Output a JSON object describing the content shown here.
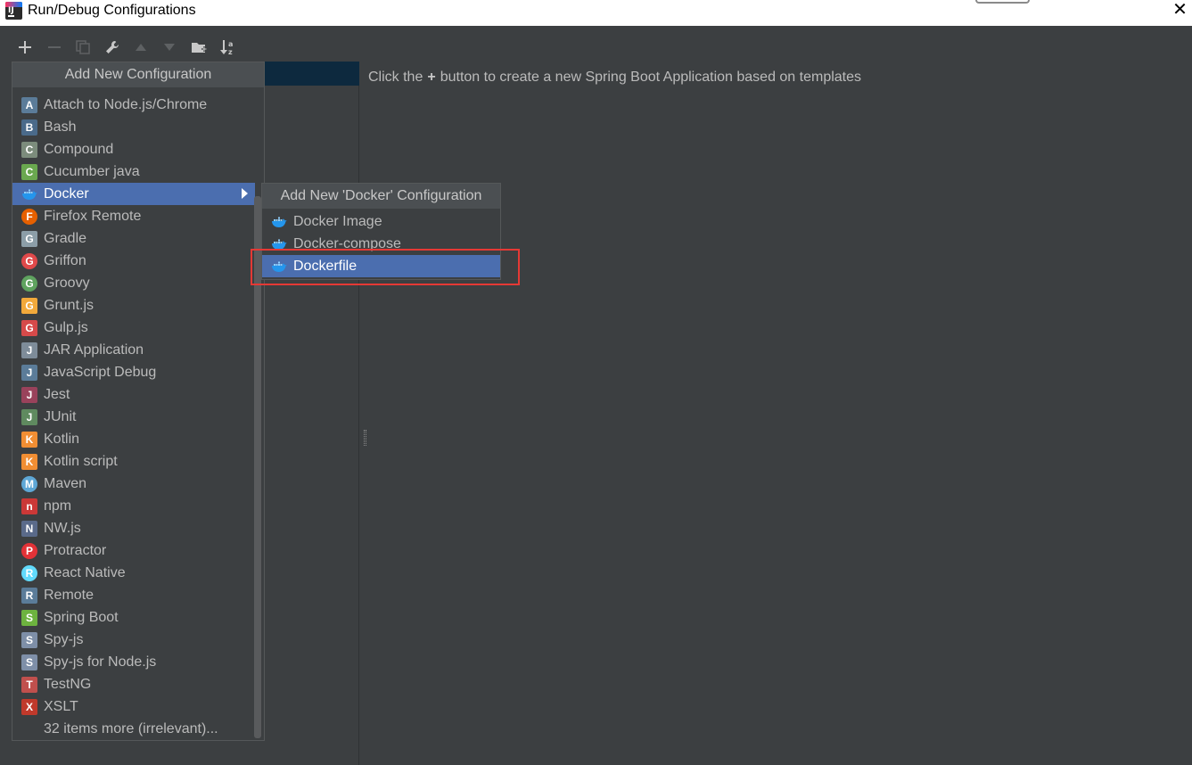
{
  "window": {
    "title": "Run/Debug Configurations",
    "close_glyph": "✕"
  },
  "toolbar": [
    {
      "name": "add-icon",
      "enabled": true
    },
    {
      "name": "remove-icon",
      "enabled": false
    },
    {
      "name": "copy-icon",
      "enabled": false
    },
    {
      "name": "wrench-icon",
      "enabled": true
    },
    {
      "name": "move-up-icon",
      "enabled": false
    },
    {
      "name": "move-down-icon",
      "enabled": false
    },
    {
      "name": "new-folder-icon",
      "enabled": true
    },
    {
      "name": "sort-icon",
      "enabled": true
    }
  ],
  "hint": {
    "before": "Click the",
    "after": "button to create a new Spring Boot Application based on templates"
  },
  "popup": {
    "title": "Add New Configuration",
    "items": [
      {
        "label": "Attach to Node.js/Chrome",
        "icon": "attach-nodejs-icon",
        "color": "#5b7c99"
      },
      {
        "label": "Bash",
        "icon": "bash-icon",
        "color": "#4a6a8a"
      },
      {
        "label": "Compound",
        "icon": "compound-icon",
        "color": "#7c8c7c"
      },
      {
        "label": "Cucumber java",
        "icon": "cucumber-icon",
        "color": "#6aa84f"
      },
      {
        "label": "Docker",
        "icon": "docker-icon",
        "color": "#2496ed",
        "selected": true,
        "has_submenu": true
      },
      {
        "label": "Firefox Remote",
        "icon": "firefox-icon",
        "color": "#e66000"
      },
      {
        "label": "Gradle",
        "icon": "gradle-icon",
        "color": "#8c9ea8"
      },
      {
        "label": "Griffon",
        "icon": "griffon-icon",
        "color": "#e0494a"
      },
      {
        "label": "Groovy",
        "icon": "groovy-icon",
        "color": "#5fa35f"
      },
      {
        "label": "Grunt.js",
        "icon": "grunt-icon",
        "color": "#f2a93b"
      },
      {
        "label": "Gulp.js",
        "icon": "gulp-icon",
        "color": "#d64a4a"
      },
      {
        "label": "JAR Application",
        "icon": "jar-icon",
        "color": "#7e8c99"
      },
      {
        "label": "JavaScript Debug",
        "icon": "javascript-debug-icon",
        "color": "#5b7c99"
      },
      {
        "label": "Jest",
        "icon": "jest-icon",
        "color": "#99425b"
      },
      {
        "label": "JUnit",
        "icon": "junit-icon",
        "color": "#5f8a5f"
      },
      {
        "label": "Kotlin",
        "icon": "kotlin-icon",
        "color": "#f18e33"
      },
      {
        "label": "Kotlin script",
        "icon": "kotlin-script-icon",
        "color": "#f18e33"
      },
      {
        "label": "Maven",
        "icon": "maven-icon",
        "color": "#5ea7d6"
      },
      {
        "label": "npm",
        "icon": "npm-icon",
        "color": "#cb3837"
      },
      {
        "label": "NW.js",
        "icon": "nwjs-icon",
        "color": "#5a6a8a"
      },
      {
        "label": "Protractor",
        "icon": "protractor-icon",
        "color": "#e23237"
      },
      {
        "label": "React Native",
        "icon": "react-native-icon",
        "color": "#61dafb"
      },
      {
        "label": "Remote",
        "icon": "remote-icon",
        "color": "#5b7c99"
      },
      {
        "label": "Spring Boot",
        "icon": "spring-boot-icon",
        "color": "#6db33f"
      },
      {
        "label": "Spy-js",
        "icon": "spy-js-icon",
        "color": "#7e8fa8"
      },
      {
        "label": "Spy-js for Node.js",
        "icon": "spy-js-node-icon",
        "color": "#7e8fa8"
      },
      {
        "label": "TestNG",
        "icon": "testng-icon",
        "color": "#c0504d"
      },
      {
        "label": "XSLT",
        "icon": "xslt-icon",
        "color": "#c0392b"
      },
      {
        "label": "32 items more (irrelevant)...",
        "icon": "",
        "color": ""
      }
    ]
  },
  "submenu": {
    "title": "Add New 'Docker' Configuration",
    "items": [
      {
        "label": "Docker Image",
        "icon": "docker-icon"
      },
      {
        "label": "Docker-compose",
        "icon": "docker-icon"
      },
      {
        "label": "Dockerfile",
        "icon": "docker-icon",
        "selected": true
      }
    ]
  }
}
